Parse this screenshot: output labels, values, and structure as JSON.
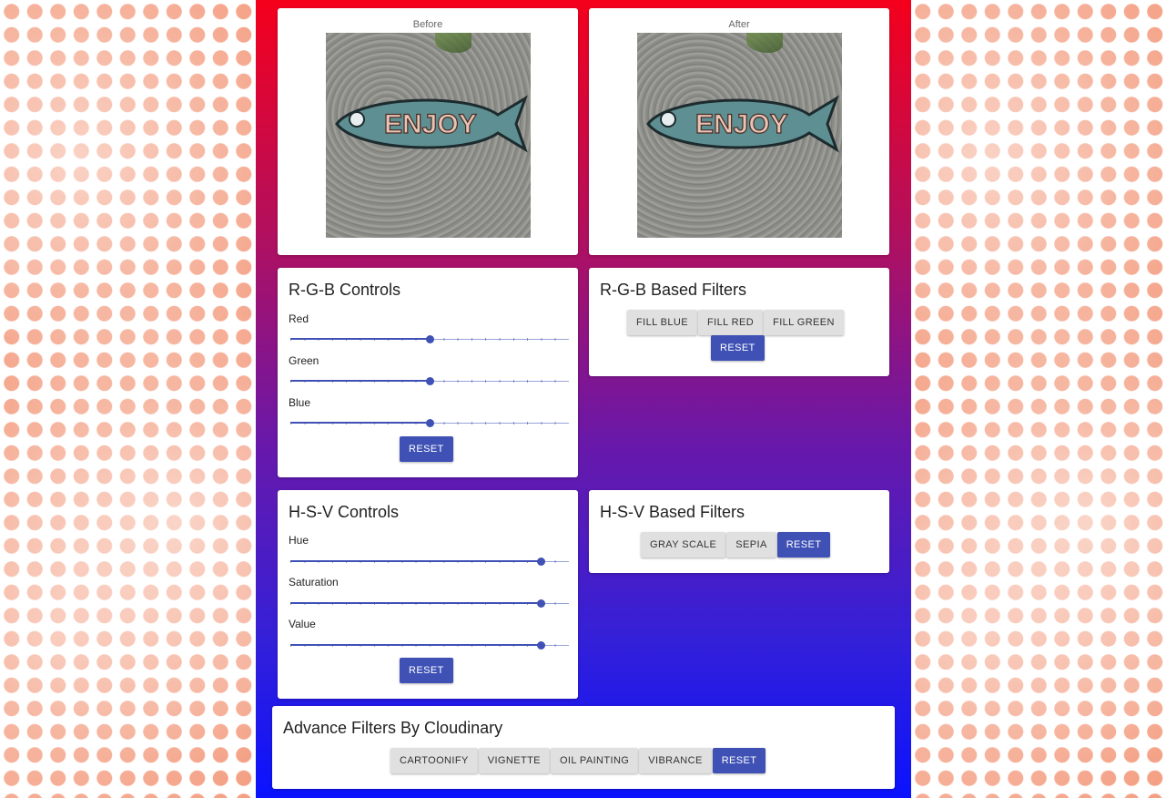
{
  "preview": {
    "before_label": "Before",
    "after_label": "After",
    "image_text": "ENJOY"
  },
  "rgb_controls": {
    "title": "R-G-B Controls",
    "sliders": [
      {
        "label": "Red",
        "value": 0.5
      },
      {
        "label": "Green",
        "value": 0.5
      },
      {
        "label": "Blue",
        "value": 0.5
      }
    ],
    "reset_label": "Reset"
  },
  "rgb_filters": {
    "title": "R-G-B Based Filters",
    "buttons": [
      "Fill Blue",
      "Fill Red",
      "Fill Green"
    ],
    "reset_label": "Reset"
  },
  "hsv_controls": {
    "title": "H-S-V Controls",
    "sliders": [
      {
        "label": "Hue",
        "value": 0.9
      },
      {
        "label": "Saturation",
        "value": 0.9
      },
      {
        "label": "Value",
        "value": 0.9
      }
    ],
    "reset_label": "Reset"
  },
  "hsv_filters": {
    "title": "H-S-V Based Filters",
    "buttons": [
      "Gray Scale",
      "Sepia"
    ],
    "reset_label": "Reset"
  },
  "advanced": {
    "title": "Advance Filters By Cloudinary",
    "buttons": [
      "Cartoonify",
      "Vignette",
      "Oil Painting",
      "Vibrance"
    ],
    "reset_label": "Reset"
  },
  "colors": {
    "accent": "#3f51b5",
    "gradient_top": "#f5001c",
    "gradient_bottom": "#0a12ff",
    "dot": "#f07c55"
  }
}
